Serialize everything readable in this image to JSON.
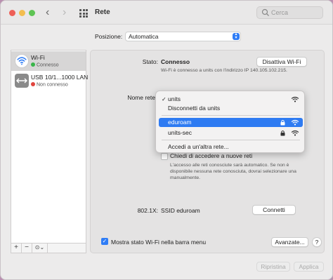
{
  "window": {
    "title": "Rete",
    "search_placeholder": "Cerca"
  },
  "location": {
    "label": "Posizione:",
    "value": "Automatica"
  },
  "sidebar": {
    "items": [
      {
        "name": "Wi-Fi",
        "status": "Connesso",
        "status_color": "#39b54a",
        "icon": "wifi-icon"
      },
      {
        "name": "USB 10/1...1000 LAN",
        "status": "Non connesso",
        "status_color": "#e0443e",
        "icon": "ethernet-icon"
      }
    ],
    "buttons": [
      "+",
      "−",
      "⊙⌄"
    ]
  },
  "detail": {
    "status_label": "Stato:",
    "status_value": "Connesso",
    "disable_button": "Disattiva Wi-Fi",
    "status_description": "Wi-Fi è connesso a units con l'indirizzo IP 140.105.102.215.",
    "network_label": "Nome rete",
    "ask_label": "Chiedi di accedere a nuove reti",
    "ask_description_1": "L'accesso alle reti conosciute sarà automatico. Se non è",
    "ask_description_2": "disponibile nessuna rete conosciuta, dovrai selezionare una",
    "ask_description_3": "manualmente.",
    "auth_label": "802.1X:",
    "auth_value": "SSID eduroam",
    "connect_button": "Connetti",
    "show_status_label": "Mostra stato Wi-Fi nella barra menu",
    "advanced_button": "Avanzate...",
    "question_button": "?"
  },
  "network_menu": {
    "current": "units",
    "disconnect": "Disconnetti da units",
    "networks": [
      {
        "name": "eduroam",
        "locked": true,
        "highlighted": true
      },
      {
        "name": "units-sec",
        "locked": true,
        "highlighted": false
      }
    ],
    "other": "Accedi a un'altra rete..."
  },
  "footer": {
    "revert_button": "Ripristina",
    "apply_button": "Applica"
  },
  "colors": {
    "accent": "#2f7df6",
    "highlight": "#2e7bf2"
  }
}
